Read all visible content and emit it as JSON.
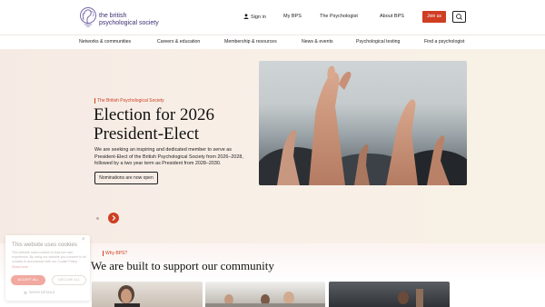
{
  "brand": {
    "name_line1": "the british",
    "name_line2": "psychological society",
    "color": "#3d2e73"
  },
  "topnav": {
    "sign_in": "Sign in",
    "items": [
      "My BPS",
      "The Psychologist",
      "About BPS"
    ],
    "join": "Join us",
    "search_icon": "search-icon",
    "accent": "#cf3e22"
  },
  "mainnav": {
    "items": [
      "Networks & communities",
      "Careers & education",
      "Membership & resources",
      "News & events",
      "Psychological testing",
      "Find a psychologist"
    ]
  },
  "hero": {
    "eyebrow": "The British Psychological Society",
    "title": "Election for 2026 President-Elect",
    "body": "We are seeking an inspiring and dedicated member to serve as President-Elect of the British Psychological Society from 2026–2028, followed by a two year term as President from 2028–2030.",
    "button": "Nominations are now open",
    "next_icon": "chevron-right-icon"
  },
  "section": {
    "eyebrow": "Why BPS?",
    "title": "We are built to support our community"
  },
  "cookie": {
    "title": "This website uses cookies",
    "text": "This website uses cookies to improve user experience. By using our website you consent to all cookies in accordance with our Cookie Policy.",
    "link": "Read more",
    "accept": "ACCEPT ALL",
    "decline": "DECLINE ALL",
    "details": "SHOW DETAILS",
    "close": "×"
  }
}
